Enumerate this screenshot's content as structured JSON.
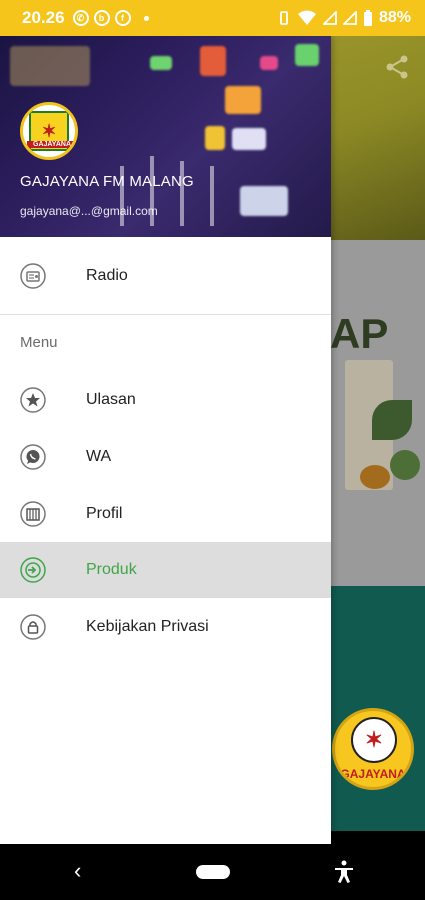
{
  "status_bar": {
    "time": "20.26",
    "battery_text": "88%",
    "icons": [
      "whatsapp-icon",
      "notification-icon",
      "facebook-icon",
      "dot-icon",
      "wifi-icon",
      "signal-icon",
      "signal-icon",
      "battery-icon"
    ]
  },
  "drawer": {
    "header": {
      "title": "GAJAYANA FM MALANG",
      "email": "gajayana@...@gmail.com",
      "logo_text": "GAJAYANA"
    },
    "items": [
      {
        "label": "Radio",
        "icon": "radio-icon"
      }
    ],
    "section_title": "Menu",
    "menu_items": [
      {
        "label": "Ulasan",
        "icon": "star-icon"
      },
      {
        "label": "WA",
        "icon": "whatsapp-icon"
      },
      {
        "label": "Profil",
        "icon": "building-icon"
      },
      {
        "label": "Produk",
        "icon": "login-icon",
        "active": true
      },
      {
        "label": "Kebijakan Privasi",
        "icon": "lock-icon"
      }
    ]
  },
  "background": {
    "ad_text": "AP",
    "logo_text": "GAJAYANA"
  },
  "colors": {
    "status_bar": "#f5c51c",
    "active_text": "#3fa648",
    "active_bg": "#dddddd",
    "teal": "#105a4f"
  }
}
